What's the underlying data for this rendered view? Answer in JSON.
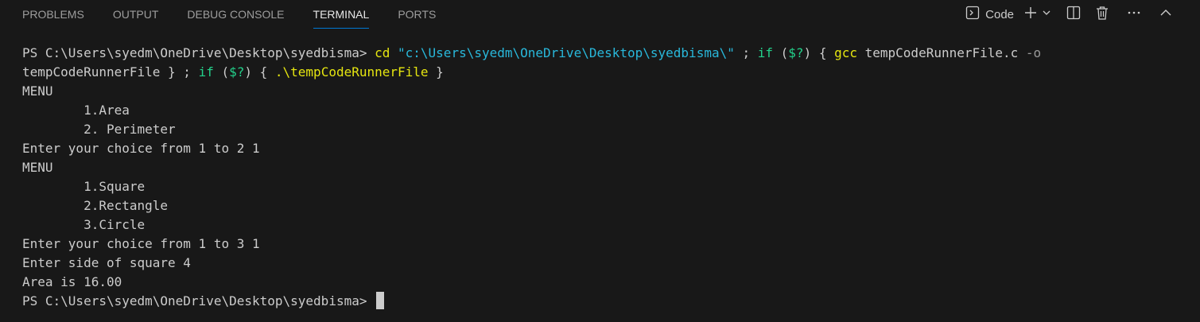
{
  "tabs": [
    {
      "label": "PROBLEMS",
      "active": false
    },
    {
      "label": "OUTPUT",
      "active": false
    },
    {
      "label": "DEBUG CONSOLE",
      "active": false
    },
    {
      "label": "TERMINAL",
      "active": true
    },
    {
      "label": "PORTS",
      "active": false
    }
  ],
  "actions": {
    "terminal_profile_label": "Code",
    "icons": [
      "terminal-icon",
      "plus-icon",
      "chevron-down-icon",
      "split-icon",
      "trash-icon",
      "more-icon",
      "chevron-up-icon"
    ]
  },
  "terminal": {
    "command_line": {
      "prompt": "PS C:\\Users\\syedm\\OneDrive\\Desktop\\syedbisma> ",
      "cmd_cd": "cd",
      "path": " \"c:\\Users\\syedm\\OneDrive\\Desktop\\syedbisma\\\"",
      "sep1": " ; ",
      "kw_if1": "if",
      "paren_open1": " (",
      "var1": "$?",
      "paren_close1": ") { ",
      "cmd_gcc": "gcc",
      "gcc_args": " tempCodeRunnerFile.c ",
      "flag": "-o",
      "wrap": "tempCodeRunnerFile } ; ",
      "kw_if2": "if",
      "paren_open2": " (",
      "var2": "$?",
      "paren_close2": ") { ",
      "cmd_run": ".\\tempCodeRunnerFile",
      "end": " }"
    },
    "output_lines": [
      "MENU",
      "        1.Area",
      "        2. Perimeter",
      "Enter your choice from 1 to 2 1",
      "MENU",
      "        1.Square",
      "        2.Rectangle",
      "        3.Circle",
      "Enter your choice from 1 to 3 1",
      "Enter side of square 4",
      "Area is 16.00"
    ],
    "final_prompt": "PS C:\\Users\\syedm\\OneDrive\\Desktop\\syedbisma> "
  },
  "colors": {
    "background": "#181818",
    "foreground": "#cccccc",
    "command": "#e5e510",
    "string": "#29b8db",
    "keyword": "#23d18b",
    "flag": "#999999",
    "active_tab_underline": "#0078d4"
  }
}
